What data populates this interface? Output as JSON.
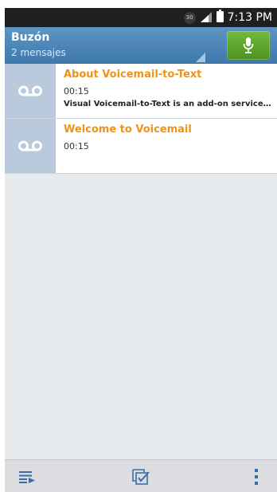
{
  "status_bar": {
    "notification_badge": "30",
    "time": "7:13 PM",
    "icons": [
      "signal-icon",
      "battery-icon"
    ]
  },
  "header": {
    "title": "Buzón",
    "subtitle": "2 mensajes",
    "mic_icon": "microphone-icon",
    "accent_color": "#4a86b8",
    "mic_button_color": "#5ea52d"
  },
  "messages": [
    {
      "icon": "voicemail-icon",
      "title": "About Voicemail-to-Text",
      "duration": "00:15",
      "preview": "Visual Voicemail-to-Text is an add-on service..."
    },
    {
      "icon": "voicemail-icon",
      "title": "Welcome to Voicemail",
      "duration": "00:15",
      "preview": ""
    }
  ],
  "colors": {
    "title_orange": "#f0921a",
    "icon_tile": "#b8cadb",
    "background": "#e8ebee"
  },
  "bottom_bar": {
    "icons": [
      "playlist-icon",
      "select-checkbox-icon",
      "overflow-menu-icon"
    ]
  }
}
